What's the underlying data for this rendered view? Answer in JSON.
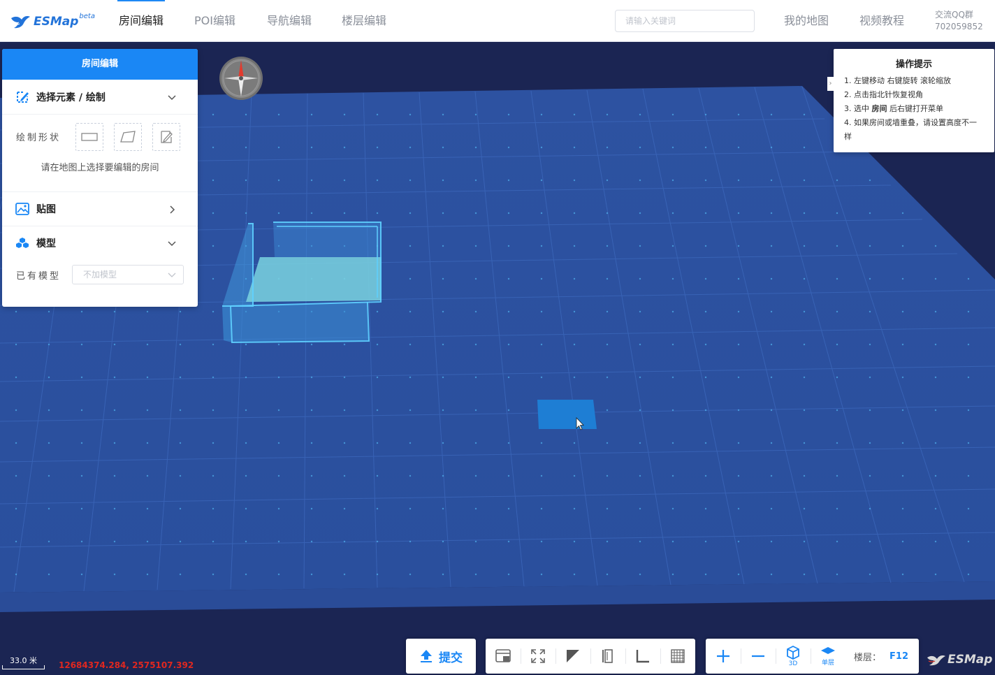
{
  "header": {
    "logo_text": "ESMap",
    "logo_badge": "beta",
    "tabs": [
      {
        "label": "房间编辑",
        "active": true
      },
      {
        "label": "POI编辑",
        "active": false
      },
      {
        "label": "导航编辑",
        "active": false
      },
      {
        "label": "楼层编辑",
        "active": false
      }
    ],
    "search_placeholder": "请输入关键词",
    "links": [
      "我的地图",
      "视频教程"
    ],
    "qq_label": "交流QQ群",
    "qq_number": "702059852"
  },
  "panel": {
    "title": "房间编辑",
    "select_section": {
      "title": "选择元素 / 绘制",
      "expanded": true
    },
    "draw_shape_label": "绘制形状",
    "shapes": [
      "rectangle-icon",
      "polygon-icon",
      "freehand-icon"
    ],
    "hint": "请在地图上选择要编辑的房间",
    "texture_section": {
      "title": "贴图",
      "expanded": false
    },
    "model_section": {
      "title": "模型",
      "expanded": true
    },
    "existing_model_label": "已有模型",
    "model_select_value": "不加模型"
  },
  "tips": {
    "title": "操作提示",
    "items": [
      {
        "pre": "1. 左键移动 右键旋转 滚轮缩放",
        "bold": "",
        "post": ""
      },
      {
        "pre": "2. 点击指北针恢复视角",
        "bold": "",
        "post": ""
      },
      {
        "pre": "3. 选中 ",
        "bold": "房间",
        "post": " 后右键打开菜单"
      },
      {
        "pre": "4. 如果房间或墙重叠，请设置高度不一样",
        "bold": "",
        "post": ""
      }
    ]
  },
  "toolbar": {
    "submit_label": "提交",
    "tools": [
      "layout-icon",
      "fullscreen-icon",
      "triangle-icon",
      "door-icon",
      "corner-icon",
      "grid-icon"
    ],
    "zoom_in": "zoom-in-icon",
    "zoom_out": "zoom-out-icon",
    "view_3d_label": "3D",
    "single_floor_label": "单层",
    "floor_label": "楼层：",
    "floor_value": "F12"
  },
  "status": {
    "scale": "33.0 米",
    "coords": "12684374.284, 2575107.392"
  },
  "colors": {
    "accent": "#1a87f5",
    "map_floor": "#2c52a0",
    "map_background": "#1b2553",
    "coords_red": "#e0271f"
  }
}
